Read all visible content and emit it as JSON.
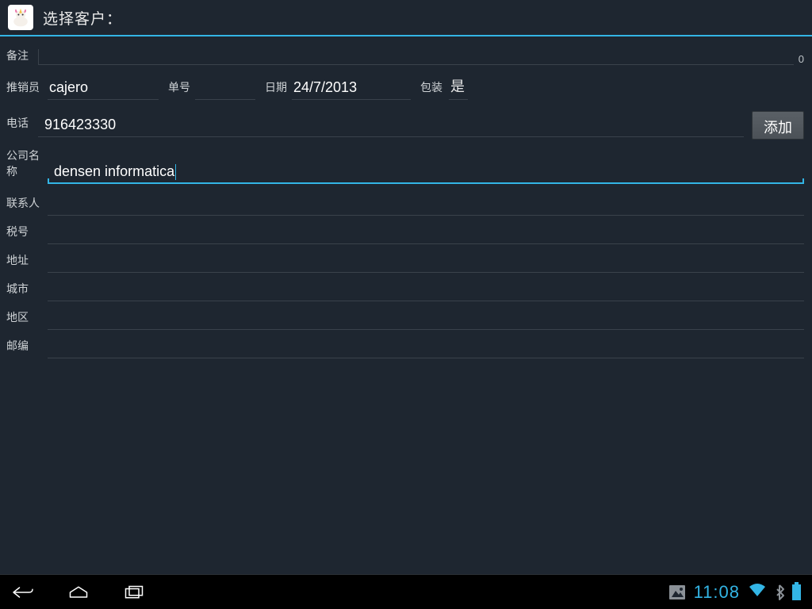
{
  "header": {
    "title": "选择客户："
  },
  "labels": {
    "remark": "备注",
    "salesman": "推销员",
    "orderno": "单号",
    "date": "日期",
    "packaging": "包装",
    "phone": "电话",
    "company": "公司名称",
    "contact": "联系人",
    "taxno": "税号",
    "address": "地址",
    "city": "城市",
    "region": "地区",
    "postcode": "邮编"
  },
  "values": {
    "remark": "",
    "remark_counter": "0",
    "salesman": "cajero",
    "orderno": "",
    "date": "24/7/2013",
    "packaging": "是",
    "phone": "916423330",
    "company": "densen informatica",
    "contact": "",
    "taxno": "",
    "address": "",
    "city": "",
    "region": "",
    "postcode": ""
  },
  "buttons": {
    "add": "添加"
  },
  "statusbar": {
    "time": "11:08"
  }
}
